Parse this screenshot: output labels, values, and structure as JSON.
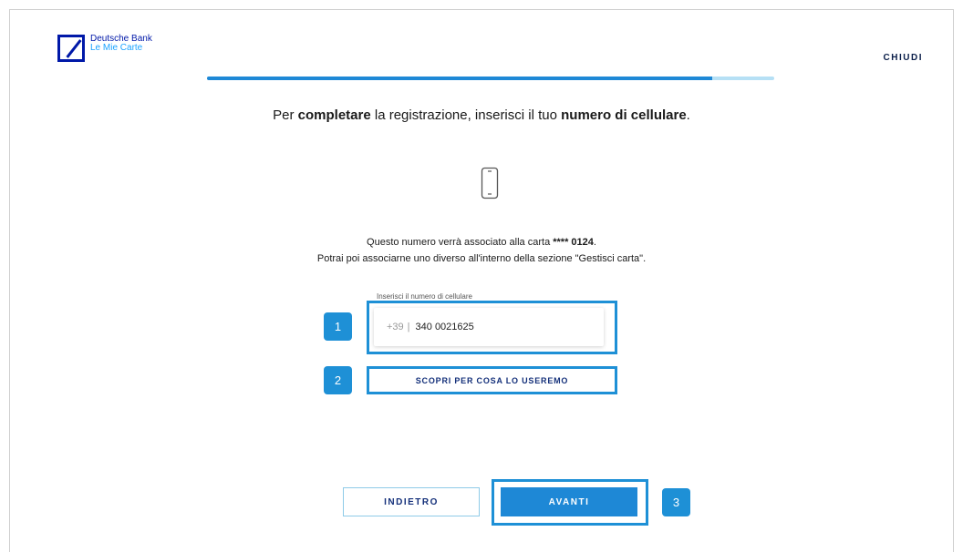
{
  "header": {
    "logo_name": "Deutsche Bank",
    "logo_sub": "Le Mie Carte",
    "close_label": "CHIUDI"
  },
  "progress": {
    "value_percent": 89
  },
  "headline": {
    "part1": "Per ",
    "bold1": "completare",
    "part2": " la registrazione, inserisci il tuo ",
    "bold2": "numero di cellulare",
    "part3": "."
  },
  "info": {
    "line1_prefix": "Questo numero verrà associato alla carta ",
    "card_masked": "**** 0124",
    "line1_suffix": ".",
    "line2": "Potrai poi associarne uno diverso all'interno della sezione \"Gestisci carta\"."
  },
  "phone_field": {
    "label": "Inserisci il numero di cellulare",
    "prefix": "+39",
    "separator": "|",
    "value": "340 0021625"
  },
  "learn_link": {
    "label": "SCOPRI PER COSA LO USEREMO"
  },
  "buttons": {
    "back_label": "INDIETRO",
    "next_label": "AVANTI"
  },
  "badges": {
    "one": "1",
    "two": "2",
    "three": "3"
  },
  "colors": {
    "primary": "#1e88d6",
    "brand": "#0018a8",
    "highlight": "#1e90d6",
    "track": "#b6e0f5"
  }
}
